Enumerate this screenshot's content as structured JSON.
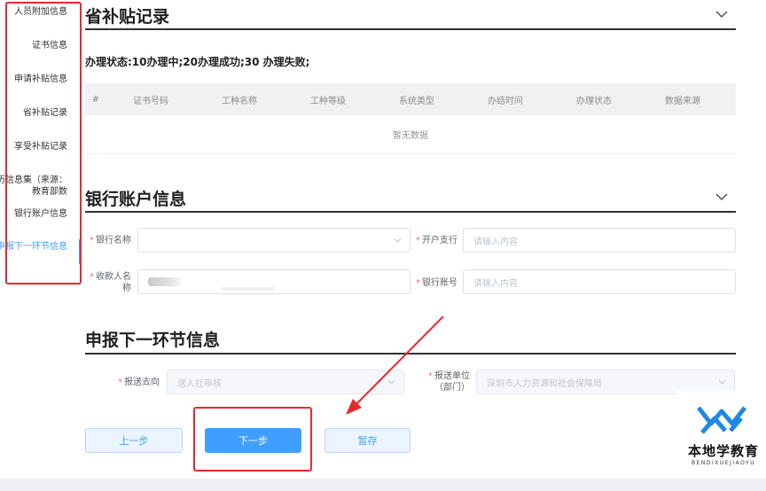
{
  "sidebar": {
    "items": [
      {
        "label": "人员附加信息",
        "active": false
      },
      {
        "label": "证书信息",
        "active": false
      },
      {
        "label": "申请补贴信息",
        "active": false
      },
      {
        "label": "省补贴记录",
        "active": false
      },
      {
        "label": "享受补贴记录",
        "active": false
      },
      {
        "label": "学历信息集（来源：教育部数",
        "active": false
      },
      {
        "label": "银行账户信息",
        "active": false
      },
      {
        "label": "申报下一环节信息",
        "active": true
      }
    ]
  },
  "subsidy_record": {
    "title": "省补贴记录",
    "status_note": "办理状态:10办理中;20办理成功;30 办理失败;",
    "table": {
      "columns": [
        "#",
        "证书号码",
        "工种名称",
        "工种等级",
        "系统类型",
        "办结时间",
        "办理状态",
        "数据来源"
      ],
      "empty_text": "暂无数据"
    }
  },
  "bank_account": {
    "title": "银行账户信息",
    "bank_name": {
      "label": "银行名称",
      "value": ""
    },
    "branch": {
      "label": "开户支行",
      "placeholder": "请输入内容"
    },
    "payee": {
      "label": "收款人名称",
      "value": ""
    },
    "account_no": {
      "label": "银行账号",
      "placeholder": "请输入内容"
    }
  },
  "next_step": {
    "title": "申报下一环节信息",
    "destination": {
      "label": "报送去向",
      "value": "送人社审核"
    },
    "unit": {
      "label": "报送单位（部门）",
      "value": "深圳市人力资源和社会保障局"
    }
  },
  "actions": {
    "prev_label": "上一步",
    "next_label": "下一步",
    "save_label": "暂存"
  },
  "watermark": {
    "name": "本地学教育",
    "pinyin": "BENDIXUEJIAOYU"
  },
  "colors": {
    "accent": "#409eff",
    "annotation": "#e8282f",
    "required": "#f56c6c"
  }
}
